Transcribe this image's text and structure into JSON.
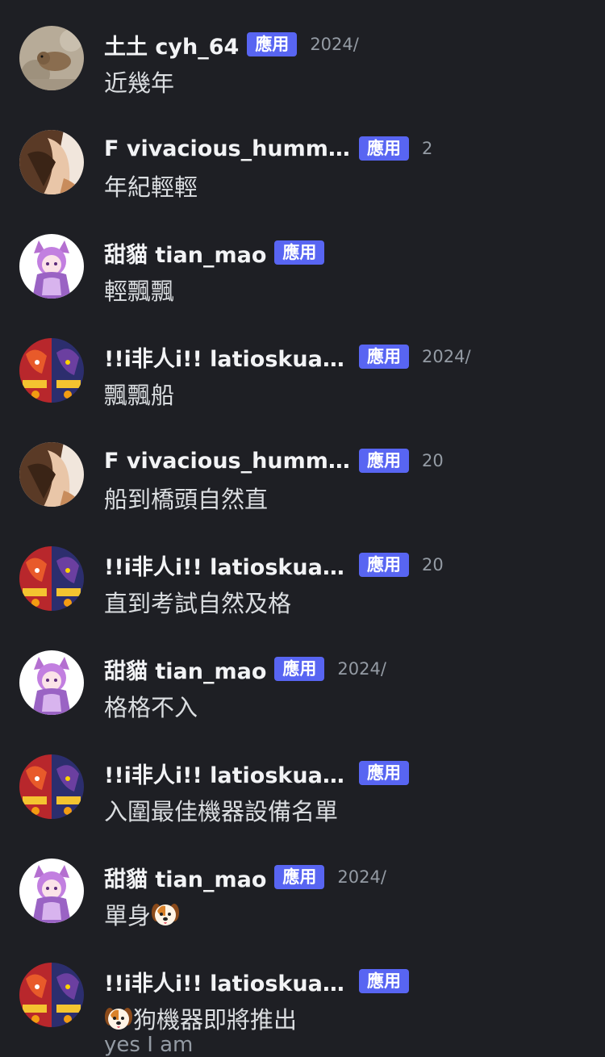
{
  "badge_label": "應用",
  "messages": [
    {
      "username": "土土 cyh_64",
      "timestamp": "2024/",
      "text": "近幾年",
      "avatar": "hamster-avatar"
    },
    {
      "username": "F vivacious_hummin...",
      "timestamp": "2",
      "text": "年紀輕輕",
      "avatar": "anime-girl-avatar"
    },
    {
      "username": "甜貓 tian_mao",
      "timestamp": "",
      "text": "輕飄飄",
      "avatar": "cat-girl-avatar"
    },
    {
      "username": "!!i非人i!! latioskuantw",
      "timestamp": "2024/",
      "text": "飄飄船",
      "avatar": "pokemon-avatar"
    },
    {
      "username": "F vivacious_hummin...",
      "timestamp": "20",
      "text": "船到橋頭自然直",
      "avatar": "anime-girl-avatar"
    },
    {
      "username": "!!i非人i!! latioskuantw",
      "timestamp": "20",
      "text": "直到考試自然及格",
      "avatar": "pokemon-avatar"
    },
    {
      "username": "甜貓 tian_mao",
      "timestamp": "2024/",
      "text": "格格不入",
      "avatar": "cat-girl-avatar"
    },
    {
      "username": "!!i非人i!! latioskuantw",
      "timestamp": "",
      "text": "入圍最佳機器設備名單",
      "avatar": "pokemon-avatar"
    },
    {
      "username": "甜貓 tian_mao",
      "timestamp": "2024/",
      "text": "單身",
      "avatar": "cat-girl-avatar",
      "trailing_emoji": "dog-face-icon"
    },
    {
      "username": "!!i非人i!! latioskuantw",
      "timestamp": "",
      "text": "狗機器即將推出",
      "avatar": "pokemon-avatar",
      "leading_emoji": "dog-face-icon"
    }
  ],
  "partial_next_text": "yes I am",
  "colors": {
    "background": "#1e1f24",
    "badge": "#5865f2",
    "username": "#f2f3f5",
    "message": "#dbdee1",
    "timestamp": "#949ba4"
  }
}
